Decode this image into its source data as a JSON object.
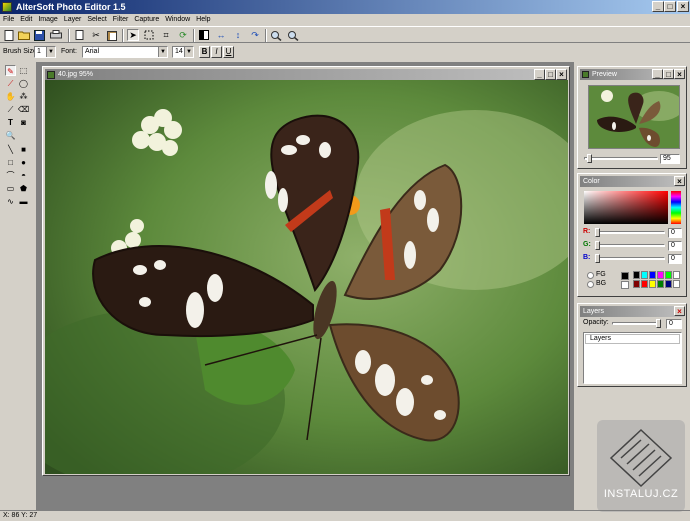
{
  "window": {
    "title": "AlterSoft Photo Editor 1.5"
  },
  "menu": [
    "File",
    "Edit",
    "Image",
    "Layer",
    "Select",
    "Filter",
    "Capture",
    "Window",
    "Help"
  ],
  "toolbar": {
    "brush_size_label": "Brush Size:",
    "brush_size_value": "1",
    "font_label": "Font:",
    "font_value": "Arial",
    "font_size_value": "14",
    "bold": "B",
    "italic": "I",
    "underline": "U"
  },
  "document": {
    "title": "40.jpg 95%"
  },
  "preview": {
    "title": "Preview",
    "zoom_value": "95"
  },
  "color": {
    "title": "Color",
    "r_label": "R:",
    "g_label": "G:",
    "b_label": "B:",
    "r_value": "0",
    "g_value": "0",
    "b_value": "0",
    "fg_label": "FG",
    "bg_label": "BG",
    "palette": [
      "#000000",
      "#00ffff",
      "#0000ff",
      "#ff00ff",
      "#00ff00",
      "#ffffff",
      "#800000",
      "#ff0000",
      "#ffff00",
      "#008000",
      "#000080",
      "#ffffff"
    ]
  },
  "layers": {
    "title": "Layers",
    "opacity_label": "Opacity:",
    "opacity_value": "0",
    "items": [
      "Layers"
    ]
  },
  "status": {
    "coords": "X: 86 Y: 27"
  },
  "watermark": {
    "text": "INSTALUJ.CZ"
  }
}
